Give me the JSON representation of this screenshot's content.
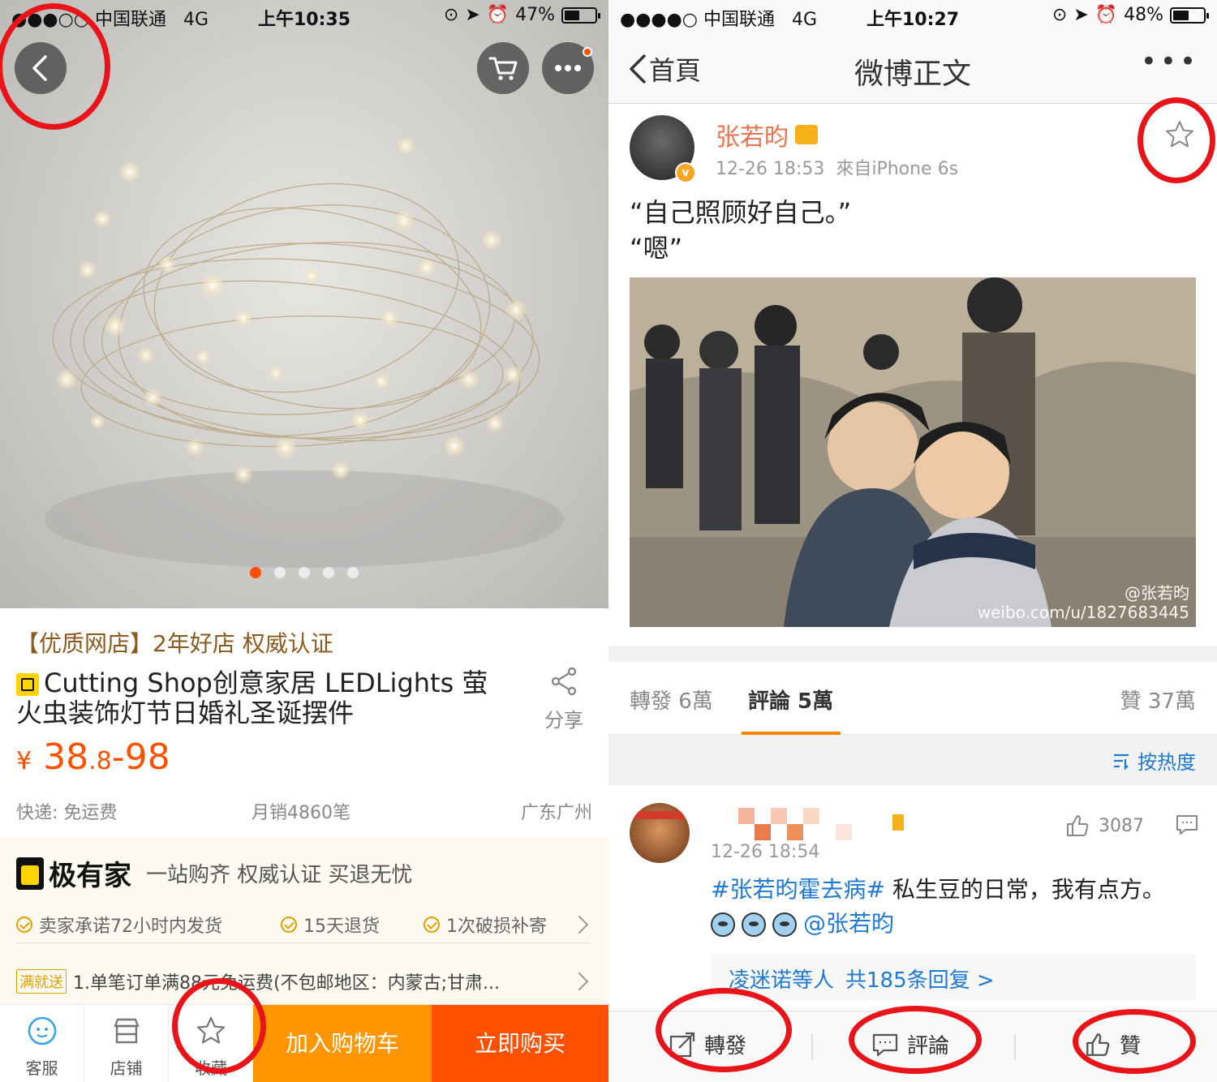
{
  "left": {
    "status": {
      "carrier": "●●●○○ 中国联通",
      "network": "4G",
      "time": "上午10:35",
      "battery": "47%",
      "battery_level": 0.47
    },
    "carousel": {
      "page_index": 1,
      "page_count": 5
    },
    "shop_line": "【优质网店】2年好店 权威认证",
    "product_title": "Cutting Shop创意家居 LEDLights 萤火虫装饰灯节日婚礼圣诞摆件",
    "share_label": "分享",
    "price": {
      "currency": "¥",
      "main": "38",
      "decimal": ".8",
      "range_end": "-98"
    },
    "shipping": "快递: 免运费",
    "monthly_sales": "月销4860笔",
    "location": "广东广州",
    "brand": {
      "name": "极有家",
      "slogan": "一站购齐 权威认证 买退无忧"
    },
    "promises": [
      "卖家承诺72小时内发货",
      "15天退货",
      "1次破损补寄"
    ],
    "promo": {
      "tag": "满就送",
      "text": "1.单笔订单满88元免运费(不包邮地区：内蒙古;甘肃..."
    },
    "bottom_bar": {
      "service": "客服",
      "store": "店铺",
      "favorite": "收藏",
      "add_to_cart": "加入购物车",
      "buy_now": "立即购买"
    },
    "colors": {
      "accent": "#ff5000",
      "cart": "#ff9500",
      "annotation": "#e8141a"
    }
  },
  "right": {
    "status": {
      "carrier": "●●●●○ 中国联通",
      "network": "4G",
      "time": "上午10:27",
      "battery": "48%",
      "battery_level": 0.48
    },
    "nav": {
      "back": "首頁",
      "title": "微博正文",
      "more": "•••"
    },
    "post": {
      "username": "张若昀",
      "time": "12-26 18:53",
      "source": "來自iPhone 6s",
      "text_line1": "“自己照顾好自己。”",
      "text_line2": "“嗯”",
      "watermark_handle": "@张若昀",
      "watermark_url": "weibo.com/u/1827683445"
    },
    "tabs": {
      "repost": "轉發 6萬",
      "comments": "評論 5萬",
      "likes": "贊 37萬"
    },
    "sort": "按热度",
    "comment": {
      "time": "12-26 18:54",
      "likes": "3087",
      "hashtag": "#张若昀霍去病#",
      "text": " 私生豆的日常，我有点方。",
      "mention": "@张若昀",
      "reply_names": "凌迷诺等人",
      "reply_count": "共185条回复 >"
    },
    "bottom_bar": {
      "repost": "轉發",
      "comment": "評論",
      "like": "贊"
    },
    "colors": {
      "username": "#eb7350",
      "link": "#1f7ad6",
      "tab_underline": "#ff8200"
    }
  }
}
